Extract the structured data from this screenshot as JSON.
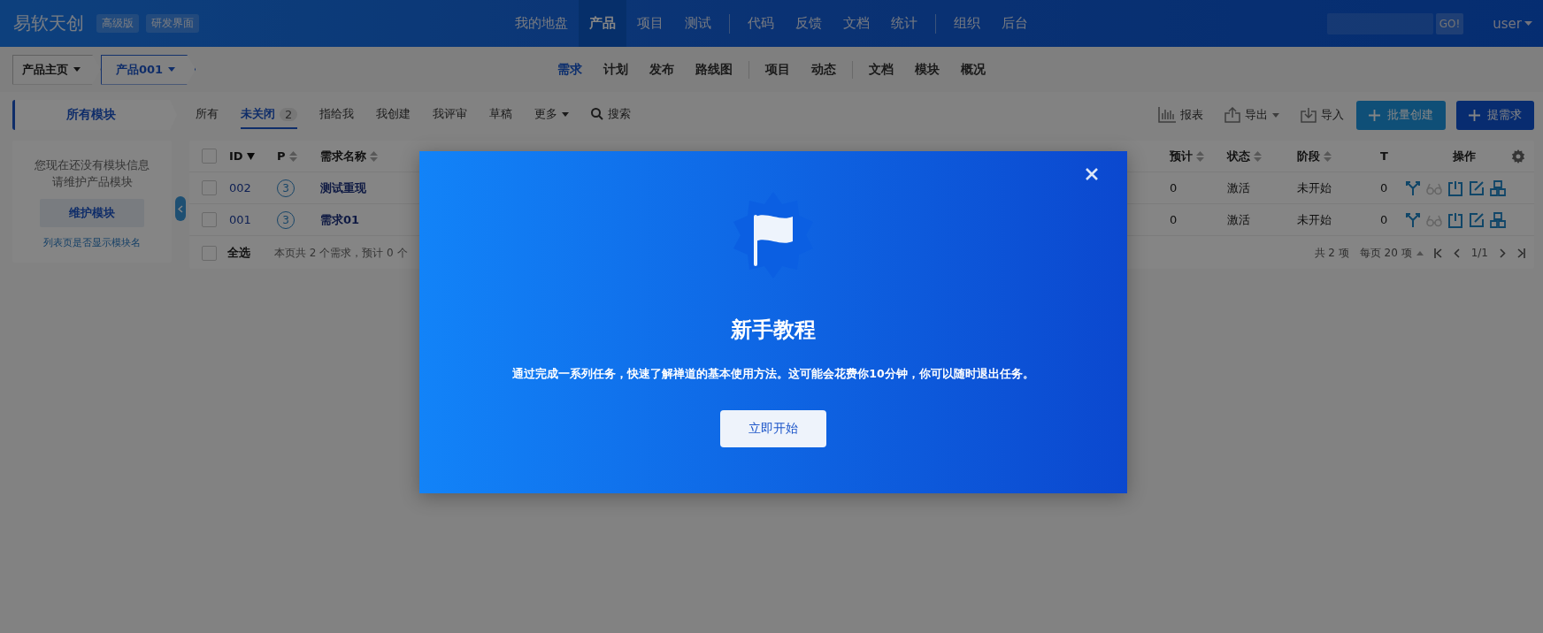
{
  "header": {
    "logo": "易软天创",
    "badges": [
      "高级版",
      "研发界面"
    ],
    "nav_groups": [
      [
        {
          "label": "我的地盘",
          "selected": false
        },
        {
          "label": "产品",
          "selected": true
        },
        {
          "label": "项目",
          "selected": false
        },
        {
          "label": "测试",
          "selected": false
        }
      ],
      [
        {
          "label": "代码",
          "selected": false
        },
        {
          "label": "反馈",
          "selected": false
        },
        {
          "label": "文档",
          "selected": false
        },
        {
          "label": "统计",
          "selected": false
        }
      ],
      [
        {
          "label": "组织",
          "selected": false
        },
        {
          "label": "后台",
          "selected": false
        }
      ]
    ],
    "search_button": "GO!",
    "user": "user"
  },
  "breadcrumb": [
    {
      "label": "产品主页",
      "selected": false
    },
    {
      "label": "产品001",
      "selected": true
    }
  ],
  "subnav_groups": [
    [
      {
        "label": "需求",
        "selected": true
      },
      {
        "label": "计划",
        "selected": false
      },
      {
        "label": "发布",
        "selected": false
      },
      {
        "label": "路线图",
        "selected": false
      }
    ],
    [
      {
        "label": "项目",
        "selected": false
      },
      {
        "label": "动态",
        "selected": false
      }
    ],
    [
      {
        "label": "文档",
        "selected": false
      },
      {
        "label": "模块",
        "selected": false
      },
      {
        "label": "概况",
        "selected": false
      }
    ]
  ],
  "sidebar": {
    "tab": "所有模块",
    "message_lines": [
      "您现在还没有模块信息",
      "请维护产品模块"
    ],
    "button": "维护模块",
    "link": "列表页是否显示模块名"
  },
  "filters": [
    {
      "label": "所有",
      "selected": false,
      "kind": "tab"
    },
    {
      "label": "未关闭",
      "selected": true,
      "kind": "tab",
      "count": "2"
    },
    {
      "label": "指给我",
      "selected": false,
      "kind": "tab"
    },
    {
      "label": "我创建",
      "selected": false,
      "kind": "tab"
    },
    {
      "label": "我评审",
      "selected": false,
      "kind": "tab"
    },
    {
      "label": "草稿",
      "selected": false,
      "kind": "tab"
    },
    {
      "label": "更多",
      "selected": false,
      "kind": "dropdown"
    },
    {
      "label": "搜索",
      "selected": false,
      "kind": "search"
    }
  ],
  "tools": [
    {
      "label": "报表",
      "kind": "report"
    },
    {
      "label": "导出",
      "kind": "export"
    },
    {
      "label": "导入",
      "kind": "import"
    }
  ],
  "buttons": [
    {
      "label": "批量创建",
      "kind": "secondary"
    },
    {
      "label": "提需求",
      "kind": "primary"
    }
  ],
  "table": {
    "header_checked": false,
    "columns": [
      {
        "label": "ID",
        "sortable": true,
        "sorted": true
      },
      {
        "label": "P",
        "sortable": true,
        "sorted": false
      },
      {
        "label": "需求名称",
        "sortable": true,
        "sorted": false
      },
      {
        "kind": "covered"
      },
      {
        "kind": "covered"
      },
      {
        "kind": "covered"
      },
      {
        "label": "预计",
        "sortable": true,
        "sorted": false
      },
      {
        "label": "状态",
        "sortable": true,
        "sorted": false
      },
      {
        "label": "阶段",
        "sortable": true,
        "sorted": false
      },
      {
        "label": "T"
      },
      {
        "label": "操作",
        "kind": "actions"
      }
    ],
    "rows": [
      {
        "checked": false,
        "id": "002",
        "pri": "3",
        "title": "测试重现",
        "estimate": "0",
        "status": "激活",
        "stage": "未开始",
        "t": "0",
        "actions": [
          {
            "kind": "change",
            "disabled": false
          },
          {
            "kind": "review",
            "disabled": true
          },
          {
            "kind": "close",
            "disabled": false
          },
          {
            "kind": "edit",
            "disabled": false
          },
          {
            "kind": "case",
            "disabled": false
          }
        ]
      },
      {
        "checked": false,
        "id": "001",
        "pri": "3",
        "title": "需求01",
        "estimate": "0",
        "status": "激活",
        "stage": "未开始",
        "t": "0",
        "actions": [
          {
            "kind": "change",
            "disabled": false
          },
          {
            "kind": "review",
            "disabled": true
          },
          {
            "kind": "close",
            "disabled": false
          },
          {
            "kind": "edit",
            "disabled": false
          },
          {
            "kind": "case",
            "disabled": false
          }
        ]
      }
    ],
    "footer": {
      "select_all": "全选",
      "select_all_checked": false,
      "summary": "本页共 2 个需求，预计 0 个",
      "total": "共 2 项",
      "per_page": "每页 20 项",
      "page": "1/1"
    }
  },
  "modal": {
    "title": "新手教程",
    "description": "通过完成一系列任务，快速了解禅道的基本使用方法。这可能会花费你10分钟，你可以随时退出任务。",
    "button": "立即开始"
  }
}
